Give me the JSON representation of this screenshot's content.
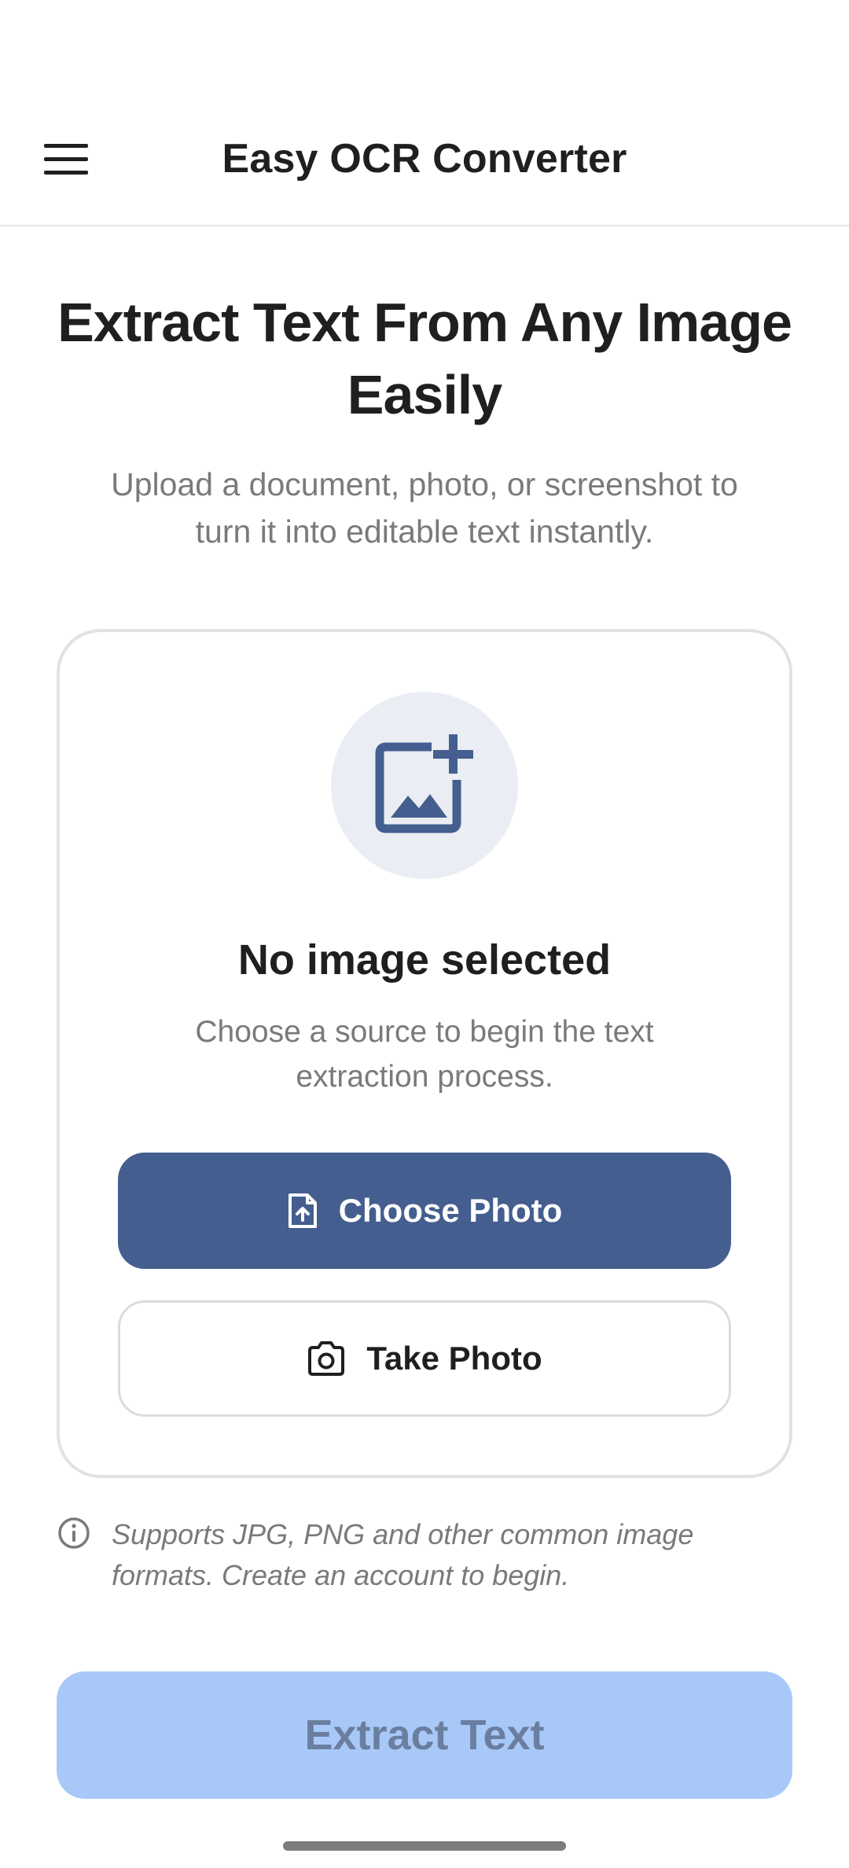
{
  "header": {
    "title": "Easy OCR Converter",
    "menu_icon": "hamburger-menu-icon"
  },
  "hero": {
    "title": "Extract Text From Any Image Easily",
    "subtitle": "Upload a document, photo, or screenshot to turn it into editable text instantly."
  },
  "upload_card": {
    "icon": "add-image-icon",
    "title": "No image selected",
    "subtitle": "Choose a source to begin the text extraction process.",
    "choose_photo_label": "Choose Photo",
    "choose_photo_icon": "file-upload-icon",
    "take_photo_label": "Take Photo",
    "take_photo_icon": "camera-icon"
  },
  "info": {
    "icon": "info-icon",
    "text": "Supports JPG, PNG and other common image formats. Create an account to begin."
  },
  "extract_button": {
    "label": "Extract Text",
    "state": "disabled"
  },
  "colors": {
    "primary": "#445e8f",
    "extract_disabled_bg": "#a8c8f8",
    "extract_disabled_text": "#6a7fa0",
    "icon_circle_bg": "#eaedf4",
    "muted_text": "#7a7a7a"
  }
}
